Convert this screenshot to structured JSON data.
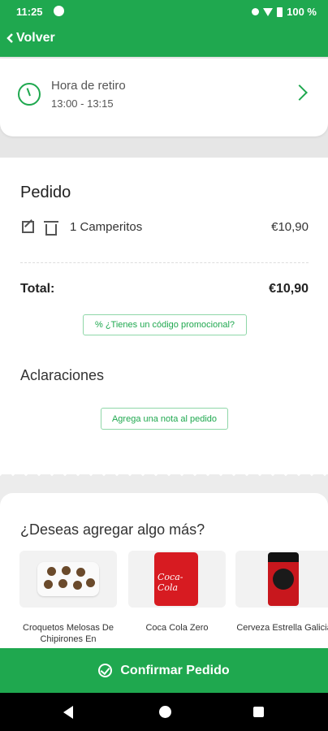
{
  "status_bar": {
    "time": "11:25",
    "battery": "100 %"
  },
  "app_bar": {
    "back_label": "Volver"
  },
  "pickup": {
    "title": "Hora de retiro",
    "time_range": "13:00 - 13:15"
  },
  "order": {
    "title": "Pedido",
    "items": [
      {
        "label": "1 Camperitos",
        "price": "€10,90"
      }
    ],
    "total_label": "Total:",
    "total_value": "€10,90",
    "promo_label": "% ¿Tienes un código promocional?",
    "notes_title": "Aclaraciones",
    "note_button_label": "Agrega una nota al pedido"
  },
  "upsell": {
    "title": "¿Deseas agregar algo más?",
    "products": [
      {
        "name": "Croquetos Melosas De Chipirones En",
        "icon": "croquettes-image"
      },
      {
        "name": "Coca Cola Zero",
        "icon": "coca-cola-can-image"
      },
      {
        "name": "Cerveza Estrella Galicia",
        "icon": "beer-can-image"
      }
    ]
  },
  "confirm": {
    "label": "Confirmar Pedido"
  },
  "colors": {
    "brand": "#1fa84f",
    "background": "#ececec"
  }
}
